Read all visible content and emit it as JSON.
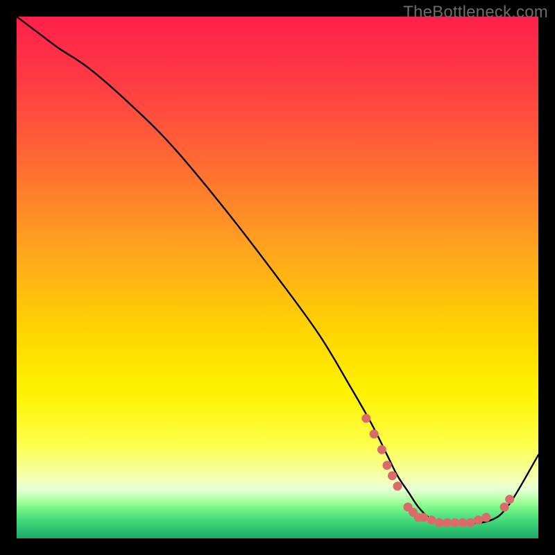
{
  "watermark": "TheBottleneck.com",
  "colors": {
    "frame": "#000000",
    "curve": "#000000",
    "marker_fill": "#dd6a6a",
    "marker_stroke": "#b84f4f",
    "gradient_stops": [
      {
        "offset": 0.0,
        "color": "#ff1f4b"
      },
      {
        "offset": 0.12,
        "color": "#ff3a44"
      },
      {
        "offset": 0.28,
        "color": "#ff6a33"
      },
      {
        "offset": 0.44,
        "color": "#ffa21f"
      },
      {
        "offset": 0.6,
        "color": "#ffd400"
      },
      {
        "offset": 0.72,
        "color": "#fff200"
      },
      {
        "offset": 0.82,
        "color": "#fdff4a"
      },
      {
        "offset": 0.885,
        "color": "#f4ffb3"
      },
      {
        "offset": 0.905,
        "color": "#e6ffd6"
      },
      {
        "offset": 0.918,
        "color": "#c8ffba"
      },
      {
        "offset": 0.93,
        "color": "#a0ff9a"
      },
      {
        "offset": 0.942,
        "color": "#7af58a"
      },
      {
        "offset": 0.955,
        "color": "#58e680"
      },
      {
        "offset": 0.97,
        "color": "#3ed378"
      },
      {
        "offset": 0.985,
        "color": "#2abf6f"
      },
      {
        "offset": 1.0,
        "color": "#19ab66"
      }
    ]
  },
  "chart_data": {
    "type": "line",
    "title": "",
    "xlabel": "",
    "ylabel": "",
    "xlim": [
      0,
      100
    ],
    "ylim": [
      0,
      100
    ],
    "series": [
      {
        "name": "bottleneck-curve",
        "x": [
          0,
          4,
          8,
          14,
          22,
          30,
          40,
          50,
          58,
          64,
          68,
          71,
          73,
          75,
          77,
          79,
          81,
          83,
          86,
          89,
          92,
          94,
          96,
          100
        ],
        "y": [
          100,
          97,
          94,
          90,
          83,
          75,
          63,
          50,
          39,
          29,
          22,
          16,
          12,
          9,
          6,
          4,
          3,
          3,
          3,
          3,
          4,
          6,
          9,
          16
        ]
      }
    ],
    "markers": {
      "name": "highlight-points",
      "points": [
        {
          "x": 67,
          "y": 23
        },
        {
          "x": 68.5,
          "y": 20
        },
        {
          "x": 70,
          "y": 17
        },
        {
          "x": 71,
          "y": 14
        },
        {
          "x": 72,
          "y": 12
        },
        {
          "x": 73,
          "y": 10
        },
        {
          "x": 75,
          "y": 6
        },
        {
          "x": 76,
          "y": 5
        },
        {
          "x": 77,
          "y": 4
        },
        {
          "x": 78,
          "y": 4
        },
        {
          "x": 79.5,
          "y": 3.5
        },
        {
          "x": 81,
          "y": 3
        },
        {
          "x": 82.5,
          "y": 3
        },
        {
          "x": 84,
          "y": 3
        },
        {
          "x": 85.5,
          "y": 3
        },
        {
          "x": 87,
          "y": 3
        },
        {
          "x": 88.5,
          "y": 3.5
        },
        {
          "x": 90,
          "y": 4
        },
        {
          "x": 93.5,
          "y": 6
        },
        {
          "x": 94.5,
          "y": 7.5
        }
      ]
    }
  }
}
